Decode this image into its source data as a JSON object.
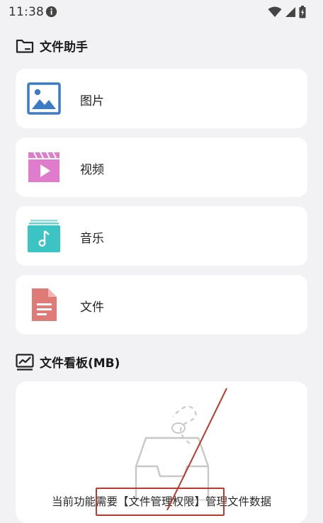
{
  "status_bar": {
    "time": "11:38"
  },
  "file_helper": {
    "title": "文件助手",
    "items": [
      {
        "label": "图片",
        "icon": "image-icon",
        "color": "#3d7bc4"
      },
      {
        "label": "视频",
        "icon": "video-icon",
        "color": "#e07bcd"
      },
      {
        "label": "音乐",
        "icon": "music-icon",
        "color": "#3cc3c3"
      },
      {
        "label": "文件",
        "icon": "document-icon",
        "color": "#e07a77"
      }
    ]
  },
  "file_board": {
    "title": "文件看板(MB)",
    "message": "当前功能需要【文件管理权限】管理文件数据"
  },
  "annotation_color": "#c0392b"
}
